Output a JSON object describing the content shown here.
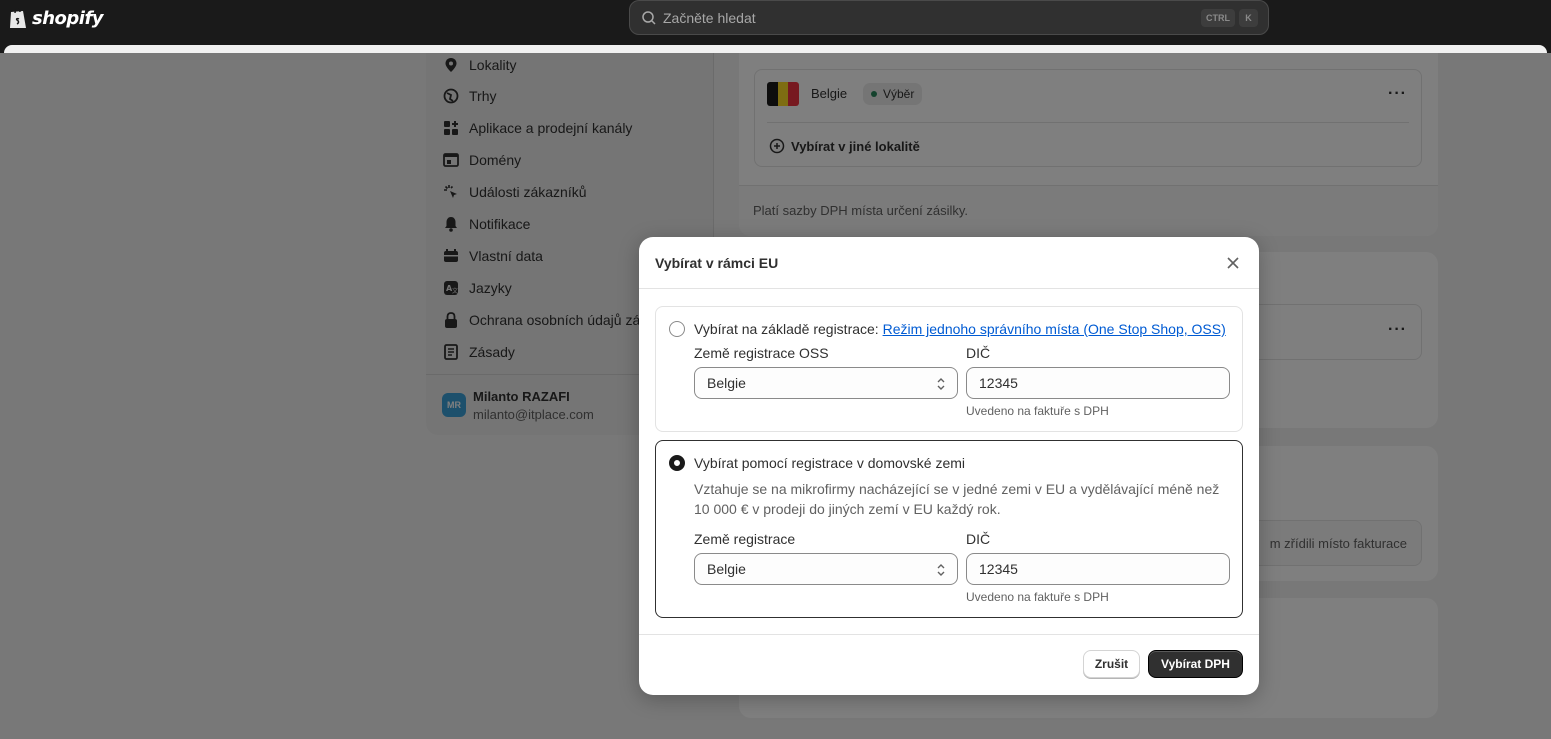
{
  "topbar": {
    "brand": "shopify",
    "search_placeholder": "Začněte hledat",
    "shortcut_ctrl": "CTRL",
    "shortcut_key": "K"
  },
  "sidebar": {
    "items": [
      {
        "label": "Lokality",
        "icon": "location-pin-icon"
      },
      {
        "label": "Trhy",
        "icon": "globe-icon"
      },
      {
        "label": "Aplikace a prodejní kanály",
        "icon": "apps-icon"
      },
      {
        "label": "Domény",
        "icon": "domain-icon"
      },
      {
        "label": "Události zákazníků",
        "icon": "cursor-click-icon"
      },
      {
        "label": "Notifikace",
        "icon": "bell-icon"
      },
      {
        "label": "Vlastní data",
        "icon": "database-icon"
      },
      {
        "label": "Jazyky",
        "icon": "translate-icon"
      },
      {
        "label": "Ochrana osobních údajů zá",
        "icon": "lock-icon"
      },
      {
        "label": "Zásady",
        "icon": "policy-icon"
      }
    ],
    "user": {
      "initials": "MR",
      "name": "Milanto RAZAFI",
      "email": "milanto@itplace.com"
    }
  },
  "background": {
    "country": "Belgie",
    "badge": "Výběr",
    "add_location": "Vybírat v jiné lokalitě",
    "footer_note": "Platí sazby DPH místa určení zásilky.",
    "card3_text": "m zřídili místo fakturace"
  },
  "modal": {
    "title": "Vybírat v rámci EU",
    "option1": {
      "title_prefix": "Vybírat na základě registrace: ",
      "link": "Režim jednoho správního místa (One Stop Shop, OSS)",
      "country_label": "Země registrace OSS",
      "country_value": "Belgie",
      "vat_label": "DIČ",
      "vat_value": "12345",
      "vat_help": "Uvedeno na faktuře s DPH",
      "selected": false
    },
    "option2": {
      "title": "Vybírat pomocí registrace v domovské zemi",
      "description": "Vztahuje se na mikrofirmy nacházející se v jedné zemi v EU a vydělávající méně než 10 000 € v prodeji do jiných zemí v EU každý rok.",
      "country_label": "Země registrace",
      "country_value": "Belgie",
      "vat_label": "DIČ",
      "vat_value": "12345",
      "vat_help": "Uvedeno na faktuře s DPH",
      "selected": true
    },
    "cancel_label": "Zrušit",
    "primary_label": "Vybírat DPH"
  },
  "colors": {
    "topbar": "#1a1a1a",
    "link": "#005bd3",
    "primary_button": "#303030",
    "badge_dot": "#29845a"
  }
}
